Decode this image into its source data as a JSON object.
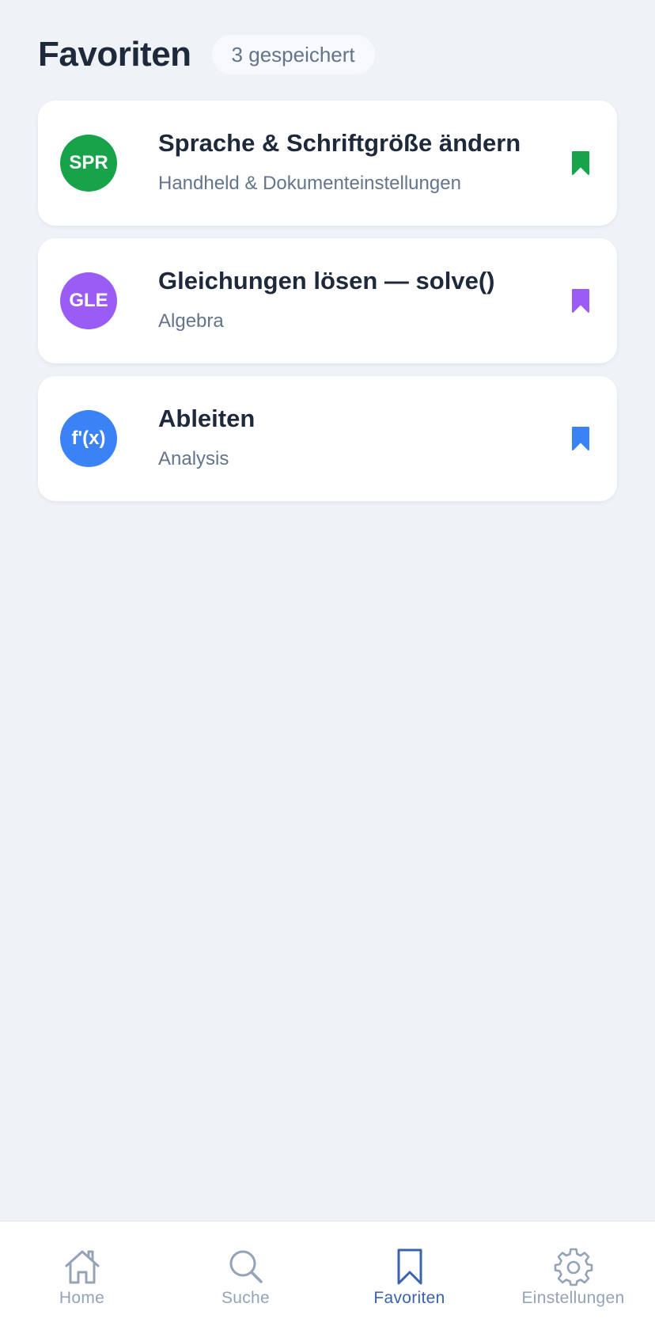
{
  "header": {
    "title": "Favoriten",
    "count_badge": "3 gespeichert"
  },
  "favorites": [
    {
      "initials": "SPR",
      "title": "Sprache & Schriftgröße ändern",
      "subtitle": "Handheld & Dokumenteinstellungen",
      "color": "#16a34a",
      "icon": "bookmark-filled-icon"
    },
    {
      "initials": "GLE",
      "title": "Gleichungen lösen — solve()",
      "subtitle": "Algebra",
      "color": "#9b5cf6",
      "icon": "bookmark-filled-icon"
    },
    {
      "initials": "f'(x)",
      "title": "Ableiten",
      "subtitle": "Analysis",
      "color": "#3b82f6",
      "icon": "bookmark-filled-icon"
    }
  ],
  "tabbar": {
    "active_color": "#3a63ad",
    "inactive_color": "#94a3b8",
    "tabs": [
      {
        "label": "Home",
        "icon": "home-icon",
        "active": false
      },
      {
        "label": "Suche",
        "icon": "search-icon",
        "active": false
      },
      {
        "label": "Favoriten",
        "icon": "bookmark-icon",
        "active": true
      },
      {
        "label": "Einstellungen",
        "icon": "gear-icon",
        "active": false
      }
    ]
  }
}
